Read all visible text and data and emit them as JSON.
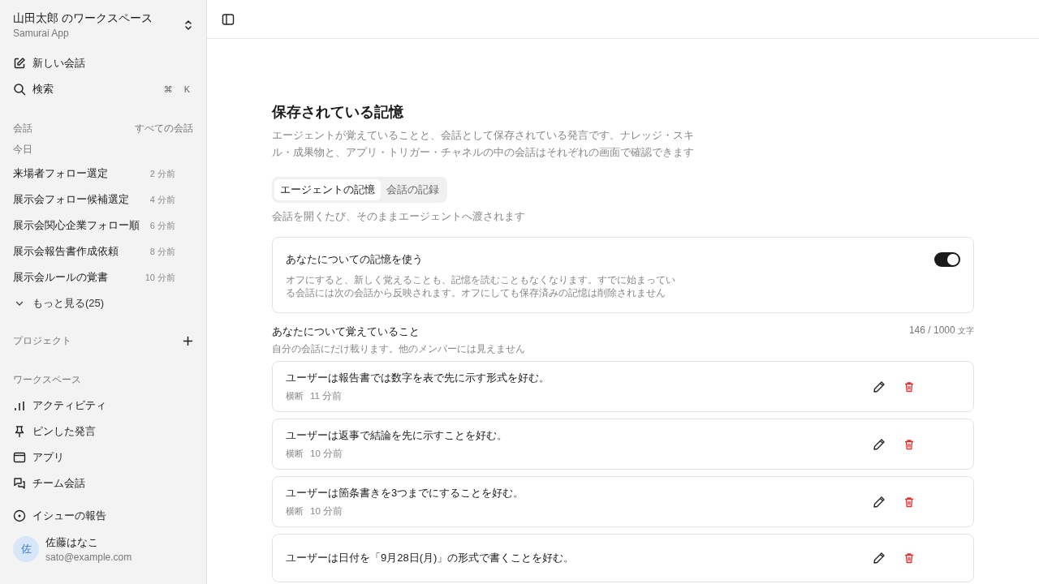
{
  "workspace": {
    "title": "山田太郎 のワークスペース",
    "subtitle": "Samurai App"
  },
  "actions": [
    {
      "kind": "new",
      "label": "新しい会話"
    },
    {
      "kind": "search",
      "label": "検索",
      "keys": [
        "⌘",
        "K"
      ]
    }
  ],
  "conversations": {
    "heading": "会話",
    "link": "すべての会話",
    "group": "今日",
    "items": [
      {
        "title": "来場者フォロー選定",
        "time": "2 分前"
      },
      {
        "title": "展示会フォロー候補選定",
        "time": "4 分前"
      },
      {
        "title": "展示会関心企業フォロー順",
        "time": "6 分前"
      },
      {
        "title": "展示会報告書作成依頼",
        "time": "8 分前"
      },
      {
        "title": "展示会ルールの覚書",
        "time": "10 分前"
      }
    ],
    "more": "もっと見る(25)"
  },
  "projects": {
    "heading": "プロジェクト"
  },
  "workspace_nav": {
    "heading": "ワークスペース",
    "items": [
      {
        "kind": "activity",
        "label": "アクティビティ"
      },
      {
        "kind": "pin",
        "label": "ピンした発言"
      },
      {
        "kind": "app",
        "label": "アプリ"
      },
      {
        "kind": "team",
        "label": "チーム会話"
      }
    ]
  },
  "report": {
    "label": "イシューの報告"
  },
  "user": {
    "initial": "佐",
    "name": "佐藤はなこ",
    "email": "sato@example.com"
  },
  "page": {
    "title": "保存されている記憶",
    "description": "エージェントが覚えていることと、会話として保存されている発言です。ナレッジ・スキル・成果物と、アプリ・トリガー・チャネルの中の会話はそれぞれの画面で確認できます"
  },
  "tabs": [
    {
      "label": "エージェントの記憶",
      "selected": true
    },
    {
      "label": "会話の記録",
      "selected": false
    }
  ],
  "tab_hint": "会話を開くたび、そのままエージェントへ渡されます",
  "setting": {
    "title": "あなたについての記憶を使う",
    "description": "オフにすると、新しく覚えることも、記憶を読むこともなくなります。すでに始まっている会話には次の会話から反映されます。オフにしても保存済みの記憶は削除されません",
    "on": true
  },
  "memories": {
    "title": "あなたについて覚えていること",
    "subtitle": "自分の会話にだけ載ります。他のメンバーには見えません",
    "count": "146 / 1000",
    "unit": "文字",
    "items": [
      {
        "text": "ユーザーは報告書では数字を表で先に示す形式を好む。",
        "scope": "横断",
        "time": "11 分前"
      },
      {
        "text": "ユーザーは返事で結論を先に示すことを好む。",
        "scope": "横断",
        "time": "10 分前"
      },
      {
        "text": "ユーザーは箇条書きを3つまでにすることを好む。",
        "scope": "横断",
        "time": "10 分前"
      },
      {
        "text": "ユーザーは日付を「9月28日(月)」の形式で書くことを好む。"
      }
    ]
  }
}
